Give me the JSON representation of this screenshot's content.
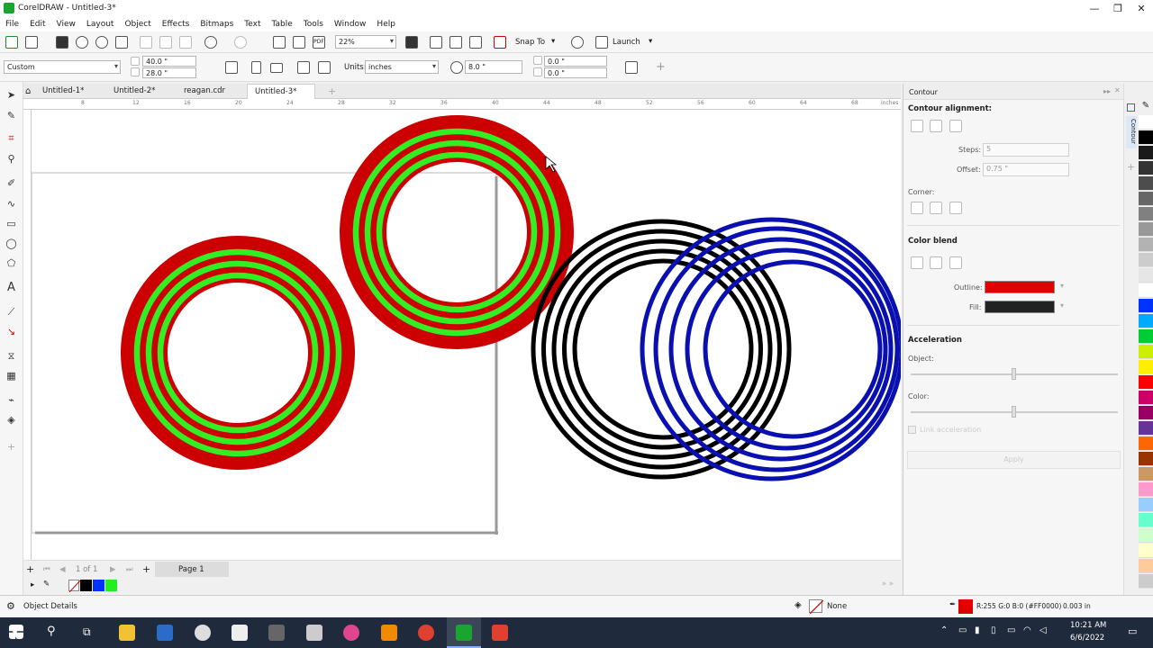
{
  "window": {
    "title": "CorelDRAW - Untitled-3*",
    "controls": [
      "—",
      "❐",
      "✕"
    ]
  },
  "menu": [
    "File",
    "Edit",
    "View",
    "Layout",
    "Object",
    "Effects",
    "Bitmaps",
    "Text",
    "Table",
    "Tools",
    "Window",
    "Help"
  ],
  "toolbar1": {
    "zoom": "22%",
    "snap_label": "Snap To",
    "launch_label": "Launch"
  },
  "toolbar2": {
    "preset": "Custom",
    "width": "40.0 \"",
    "height": "28.0 \"",
    "units_label": "Units:",
    "units_value": "inches",
    "nudge": "8.0 \"",
    "dup_x": "0.0 \"",
    "dup_y": "0.0 \""
  },
  "tabs": [
    "Untitled-1*",
    "Untitled-2*",
    "reagan.cdr",
    "Untitled-3*"
  ],
  "active_tab": 3,
  "ruler": {
    "h_ticks": [
      "8",
      "12",
      "16",
      "20",
      "24",
      "28",
      "32",
      "36",
      "40",
      "44",
      "48",
      "52",
      "56",
      "60",
      "64",
      "68"
    ],
    "unit": "inches"
  },
  "pagenav": {
    "of": "1 of 1",
    "page_label": "Page 1"
  },
  "docker": {
    "title": "Contour",
    "tab_label": "Contour",
    "alignment_label": "Contour alignment:",
    "steps_label": "Steps:",
    "steps_value": "5",
    "offset_label": "Offset:",
    "offset_value": "0.75 \"",
    "corner_label": "Corner:",
    "color_blend_label": "Color blend",
    "outline_label": "Outline:",
    "outline_color": "#e00000",
    "fill_label": "Fill:",
    "fill_color": "#222222",
    "acceleration_label": "Acceleration",
    "object_label": "Object:",
    "color_label": "Color:",
    "link_label": "Link acceleration",
    "apply_label": "Apply"
  },
  "status": {
    "object_details": "Object Details",
    "fill_none": "None",
    "color_readout": "R:255 G:0 B:0 (#FF0000)",
    "outline_width": "0.003 in"
  },
  "taskbar": {
    "time": "10:21 AM",
    "date": "6/6/2022"
  },
  "colors": {
    "ring_red": "#cc0000",
    "ring_green": "#33ee22",
    "ring_black": "#000000",
    "ring_blue": "#0a10b0"
  },
  "palette": [
    "#ffffff",
    "#000000",
    "#1a1a1a",
    "#333333",
    "#4d4d4d",
    "#666666",
    "#808080",
    "#999999",
    "#b3b3b3",
    "#cccccc",
    "#e6e6e6",
    "#ffffff",
    "#0033ff",
    "#00aaff",
    "#00cc33",
    "#ccee00",
    "#ffee00",
    "#ff0000",
    "#cc0066",
    "#990066",
    "#663399",
    "#ff6600",
    "#993300",
    "#cc9966",
    "#ff99cc",
    "#99ccff",
    "#66ffcc",
    "#ccffcc",
    "#ffffcc",
    "#ffcc99",
    "#cccccc"
  ]
}
